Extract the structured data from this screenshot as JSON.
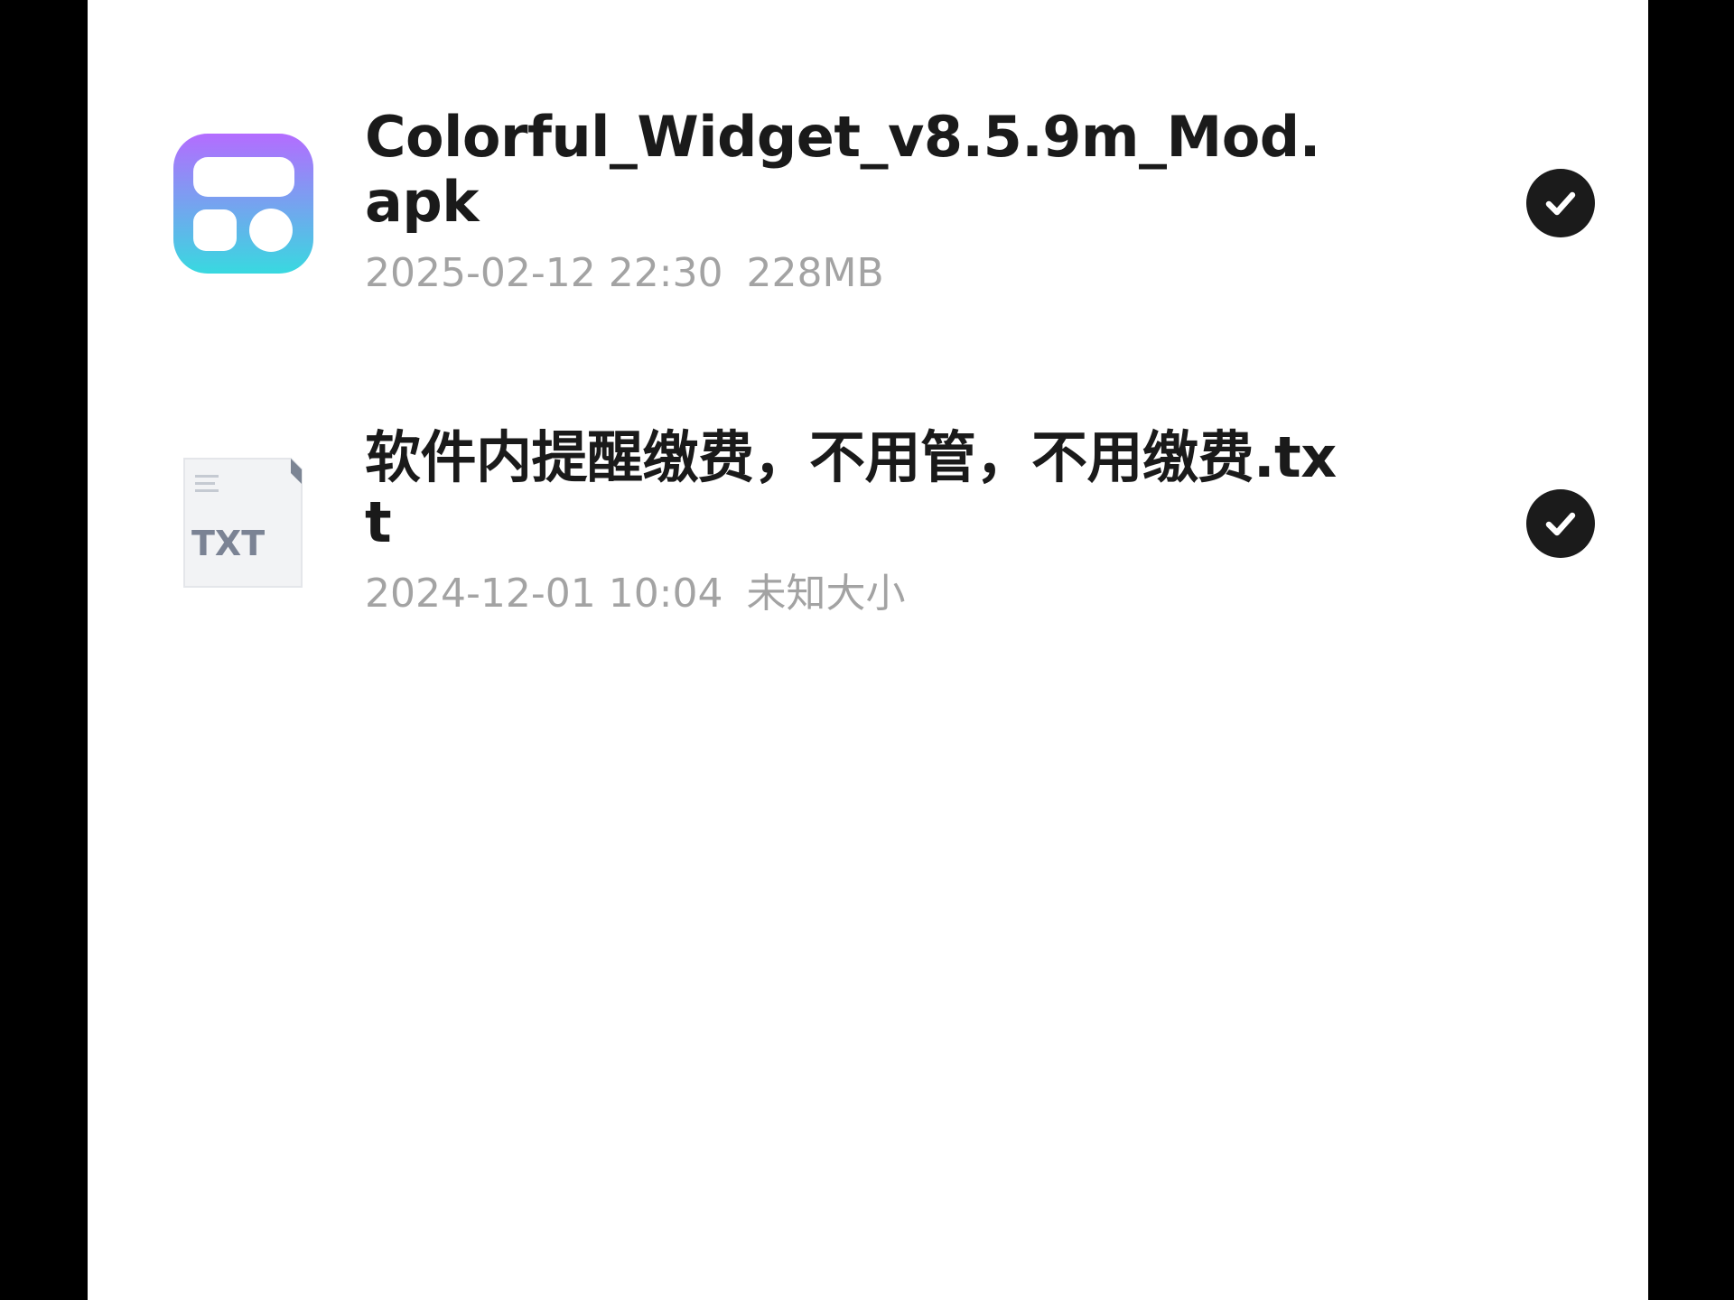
{
  "files": [
    {
      "name": "Colorful_Widget_v8.5.9m_Mod.apk",
      "date": "2025-02-12 22:30",
      "size": "228MB",
      "icon": "colorful-widget-app-icon",
      "selected": true
    },
    {
      "name": "软件内提醒缴费，不用管，不用缴费.txt",
      "date": "2024-12-01 10:04",
      "size": "未知大小",
      "icon": "txt-file-icon",
      "icon_label": "TXT",
      "selected": true
    }
  ],
  "colors": {
    "title": "#1a1a1a",
    "meta": "#a3a3a3",
    "check": "#1b1b1b",
    "background": "#ffffff"
  }
}
